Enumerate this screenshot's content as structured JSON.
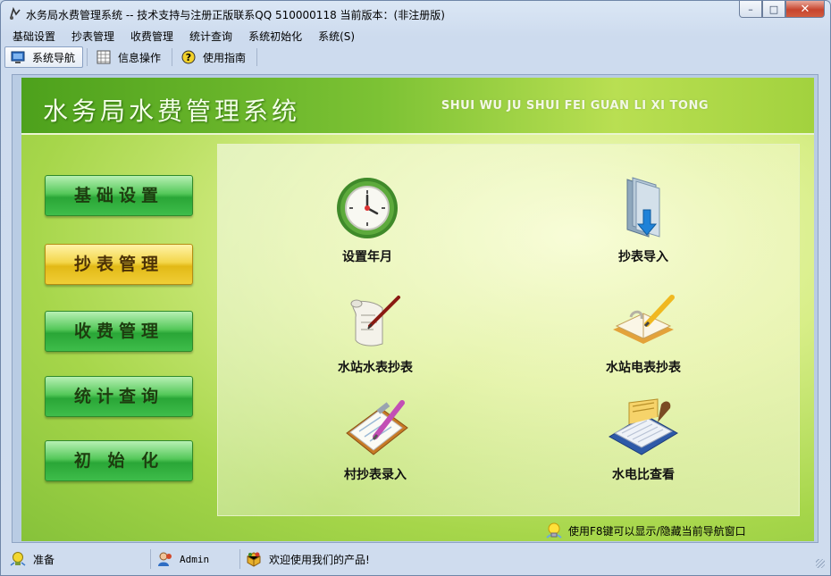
{
  "window": {
    "title": "水务局水费管理系统 -- 技术支持与注册正版联系QQ 510000118    当前版本：(非注册版)",
    "minimize_label": "–",
    "maximize_label": "□",
    "close_label": "✕"
  },
  "menubar": {
    "items": [
      "基础设置",
      "抄表管理",
      "收费管理",
      "统计查询",
      "系统初始化",
      "系统(S)"
    ]
  },
  "toolbar": {
    "buttons": [
      {
        "label": "系统导航",
        "icon": "monitor-icon",
        "active": true
      },
      {
        "label": "信息操作",
        "icon": "grid-icon",
        "active": false
      },
      {
        "label": "使用指南",
        "icon": "help-icon",
        "active": false
      }
    ]
  },
  "banner": {
    "title": "水务局水费管理系统",
    "subtitle": "SHUI WU JU SHUI FEI GUAN LI XI TONG"
  },
  "nav": {
    "buttons": [
      {
        "label": "基础设置",
        "active": false
      },
      {
        "label": "抄表管理",
        "active": true
      },
      {
        "label": "收费管理",
        "active": false
      },
      {
        "label": "统计查询",
        "active": false
      },
      {
        "label": "初 始 化",
        "active": false
      }
    ]
  },
  "features": [
    {
      "label": "设置年月",
      "icon": "clock-icon"
    },
    {
      "label": "抄表导入",
      "icon": "folder-import-icon"
    },
    {
      "label": "水站水表抄表",
      "icon": "scroll-quill-icon"
    },
    {
      "label": "水站电表抄表",
      "icon": "notebook-pencil-icon"
    },
    {
      "label": "村抄表录入",
      "icon": "clipboard-pencil-icon"
    },
    {
      "label": "水电比查看",
      "icon": "calendar-book-icon"
    }
  ],
  "hint": {
    "text": "使用F8键可以显示/隐藏当前导航窗口"
  },
  "statusbar": {
    "status": "准备",
    "user": "Admin",
    "message": "欢迎使用我们的产品!"
  },
  "colors": {
    "banner_green": "#4da11c",
    "nav_green": "#2aa637",
    "nav_active_gold": "#e2b916"
  }
}
